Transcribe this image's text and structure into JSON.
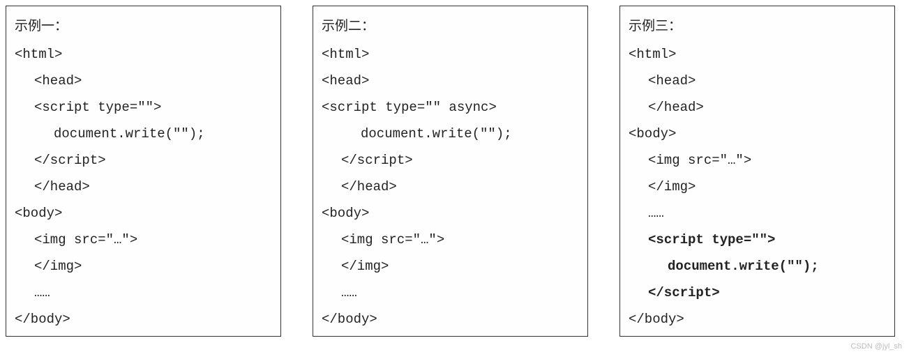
{
  "examples": [
    {
      "title": "示例一：",
      "lines": [
        {
          "text": "<html>",
          "indent": 0,
          "bold": false
        },
        {
          "text": "<head>",
          "indent": 1,
          "bold": false
        },
        {
          "text": "<script type=\"\">",
          "indent": 1,
          "bold": false
        },
        {
          "text": "document.write(\"\");",
          "indent": 2,
          "bold": false
        },
        {
          "text": "</script>",
          "indent": 1,
          "bold": false
        },
        {
          "text": "</head>",
          "indent": 1,
          "bold": false
        },
        {
          "text": "<body>",
          "indent": 0,
          "bold": false
        },
        {
          "text": "<img src=\"…\">",
          "indent": 1,
          "bold": false
        },
        {
          "text": "</img>",
          "indent": 1,
          "bold": false
        },
        {
          "text": "……",
          "indent": 1,
          "bold": false
        },
        {
          "text": "</body>",
          "indent": 0,
          "bold": false
        }
      ]
    },
    {
      "title": "示例二：",
      "lines": [
        {
          "text": "<html>",
          "indent": 0,
          "bold": false
        },
        {
          "text": "<head>",
          "indent": 0,
          "bold": false
        },
        {
          "text": "<script type=\"\" async>",
          "indent": 0,
          "bold": false
        },
        {
          "text": "document.write(\"\");",
          "indent": 2,
          "bold": false
        },
        {
          "text": "</script>",
          "indent": 1,
          "bold": false
        },
        {
          "text": "</head>",
          "indent": 1,
          "bold": false
        },
        {
          "text": "<body>",
          "indent": 0,
          "bold": false
        },
        {
          "text": "<img src=\"…\">",
          "indent": 1,
          "bold": false
        },
        {
          "text": "</img>",
          "indent": 1,
          "bold": false
        },
        {
          "text": "……",
          "indent": 1,
          "bold": false
        },
        {
          "text": "</body>",
          "indent": 0,
          "bold": false
        }
      ]
    },
    {
      "title": "示例三：",
      "lines": [
        {
          "text": "<html>",
          "indent": 0,
          "bold": false
        },
        {
          "text": "<head>",
          "indent": 1,
          "bold": false
        },
        {
          "text": "</head>",
          "indent": 1,
          "bold": false
        },
        {
          "text": "<body>",
          "indent": 0,
          "bold": false
        },
        {
          "text": "<img src=\"…\">",
          "indent": 1,
          "bold": false
        },
        {
          "text": "</img>",
          "indent": 1,
          "bold": false
        },
        {
          "text": "……",
          "indent": 1,
          "bold": false
        },
        {
          "text": "<script type=\"\">",
          "indent": 1,
          "bold": true
        },
        {
          "text": "document.write(\"\");",
          "indent": 2,
          "bold": true
        },
        {
          "text": "</script>",
          "indent": 1,
          "bold": true
        },
        {
          "text": "</body>",
          "indent": 0,
          "bold": false
        }
      ]
    }
  ],
  "watermark": "CSDN @jyl_sh"
}
